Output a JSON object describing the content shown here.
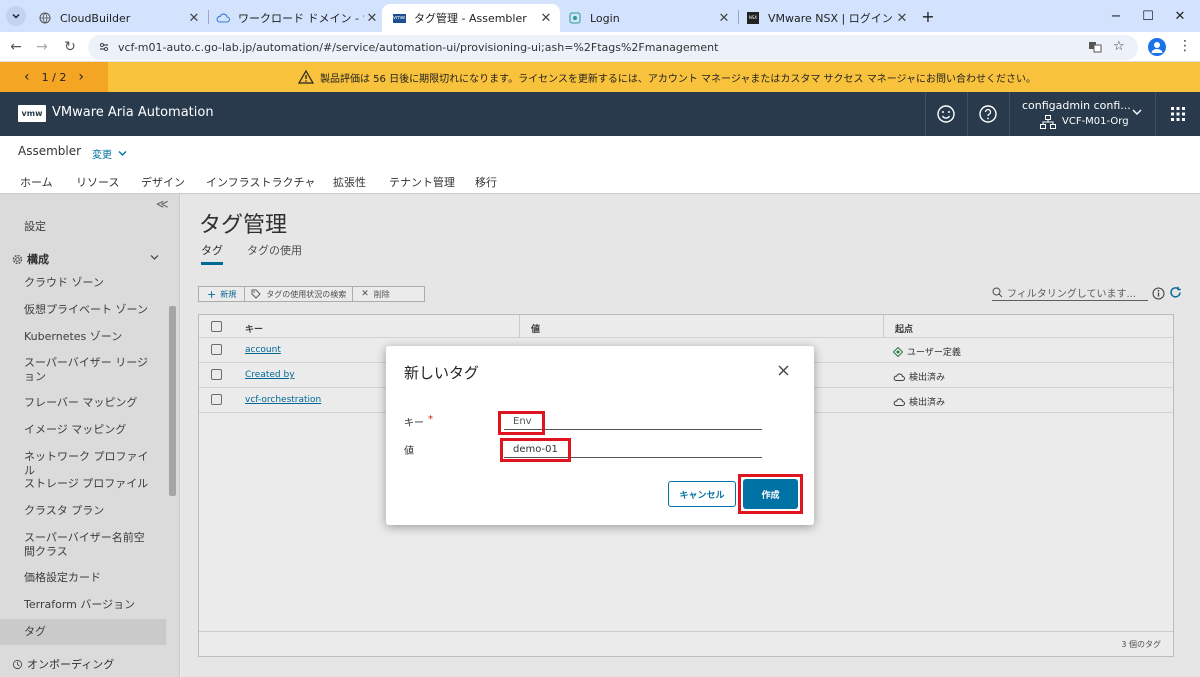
{
  "browser": {
    "tabs": [
      {
        "title": "CloudBuilder",
        "active": false
      },
      {
        "title": "ワークロード ドメイン - サマリ",
        "active": false
      },
      {
        "title": "タグ管理 - Assembler",
        "active": true
      },
      {
        "title": "Login",
        "active": false
      },
      {
        "title": "VMware NSX | ログイン",
        "active": false
      }
    ],
    "new_tab": "+",
    "window_controls": {
      "minimize": "−",
      "maximize": "☐",
      "close": "✕"
    },
    "url": "vcf-m01-auto.c.go-lab.jp/automation/#/service/automation-ui/provisioning-ui;ash=%2Ftags%2Fmanagement"
  },
  "banner": {
    "pager": "1 / 2",
    "prev": "‹",
    "next": "›",
    "message": "製品評価は 56 日後に期限切れになります。ライセンスを更新するには、アカウント マネージャまたはカスタマ サクセス マネージャにお問い合わせください。"
  },
  "app_header": {
    "logo": "vmw",
    "title": "VMware Aria Automation",
    "user": "configadmin confi...",
    "org": "VCF-M01-Org"
  },
  "sub_header": {
    "service": "Assembler",
    "change": "変更",
    "tabs": [
      "ホーム",
      "リソース",
      "デザイン",
      "インフラストラクチャ",
      "拡張性",
      "テナント管理",
      "移行"
    ],
    "active_tab": "インフラストラクチャ"
  },
  "sidebar": {
    "collapse": "≪",
    "settings": "設定",
    "section": "構成",
    "items": [
      "クラウド ゾーン",
      "仮想プライベート ゾーン",
      "Kubernetes ゾーン",
      "スーパーバイザー リージョン",
      "フレーバー マッピング",
      "イメージ マッピング",
      "ネットワーク プロファイル",
      "ストレージ プロファイル",
      "クラスタ プラン",
      "スーパーバイザー名前空間クラス",
      "価格設定カード",
      "Terraform バージョン",
      "タグ"
    ],
    "active_item": "タグ",
    "onboarding": "オンボーディング"
  },
  "main": {
    "page_title": "タグ管理",
    "tabs": [
      "タグ",
      "タグの使用"
    ],
    "toolbar": {
      "new": "新規",
      "search_usage": "タグの使用状況の検索",
      "delete": "削除",
      "filter_placeholder": "フィルタリングしています..."
    },
    "table": {
      "headers": [
        "キー",
        "値",
        "起点"
      ],
      "rows": [
        {
          "key": "account",
          "value": "",
          "origin": "ユーザー定義",
          "origin_icon": "user-defined-icon"
        },
        {
          "key": "Created by",
          "value": "",
          "origin": "検出済み",
          "origin_icon": "cloud-icon"
        },
        {
          "key": "vcf-orchestration",
          "value": "",
          "origin": "検出済み",
          "origin_icon": "cloud-icon"
        }
      ],
      "footer": "3 個のタグ"
    }
  },
  "modal": {
    "title": "新しいタグ",
    "key_label": "キー",
    "required_mark": "*",
    "key_value": "Env",
    "value_label": "値",
    "value_value": "demo-01",
    "cancel": "キャンセル",
    "create": "作成"
  },
  "colors": {
    "header_bg": "#283a4b",
    "banner_bg": "#f9c23c",
    "accent": "#0072a3",
    "highlight": "#e0141e"
  }
}
